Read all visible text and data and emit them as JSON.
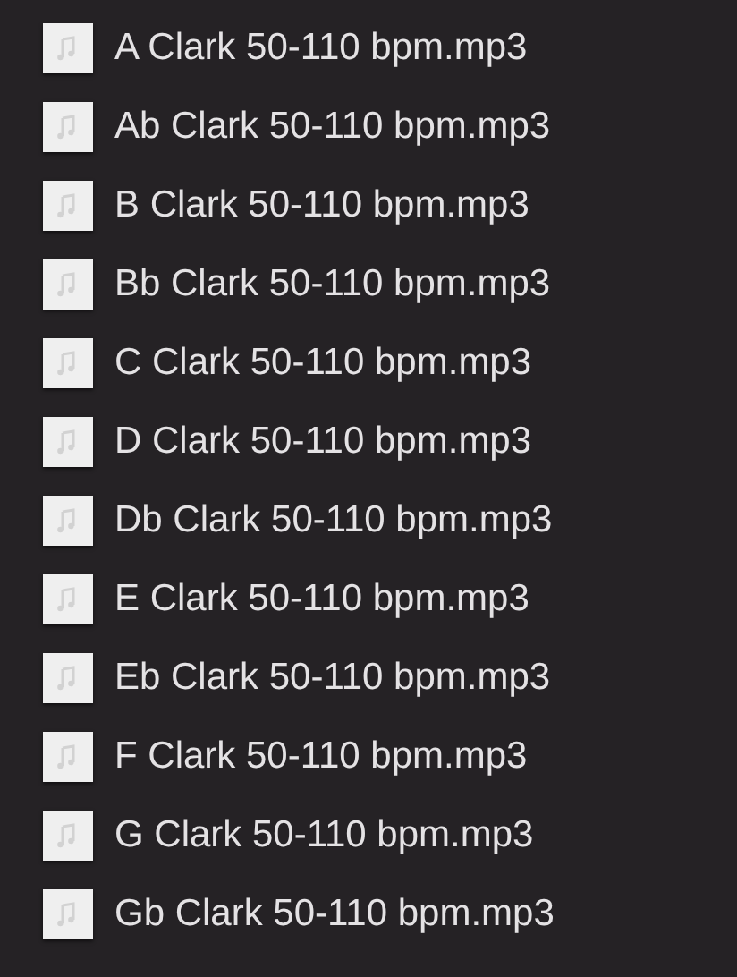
{
  "files": [
    {
      "name": "A Clark 50-110 bpm.mp3"
    },
    {
      "name": "Ab Clark 50-110 bpm.mp3"
    },
    {
      "name": "B Clark 50-110 bpm.mp3"
    },
    {
      "name": "Bb Clark 50-110 bpm.mp3"
    },
    {
      "name": "C Clark 50-110 bpm.mp3"
    },
    {
      "name": "D Clark 50-110 bpm.mp3"
    },
    {
      "name": "Db Clark 50-110 bpm.mp3"
    },
    {
      "name": "E Clark 50-110 bpm.mp3"
    },
    {
      "name": "Eb Clark 50-110 bpm.mp3"
    },
    {
      "name": "F Clark 50-110 bpm.mp3"
    },
    {
      "name": "G Clark 50-110 bpm.mp3"
    },
    {
      "name": "Gb Clark 50-110 bpm.mp3"
    }
  ]
}
